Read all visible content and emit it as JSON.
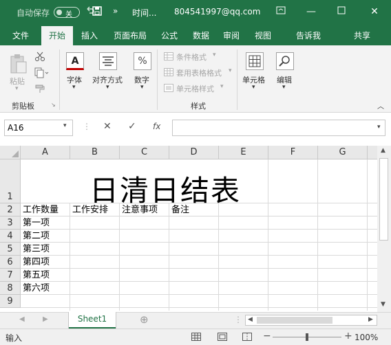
{
  "titlebar": {
    "autosave_label": "自动保存",
    "autosave_state": "关",
    "filename": "时间...",
    "account": "804541997@qq.com"
  },
  "tabs": [
    "文件",
    "开始",
    "插入",
    "页面布局",
    "公式",
    "数据",
    "审阅",
    "视图",
    "告诉我",
    "共享"
  ],
  "ribbon": {
    "paste": "粘贴",
    "clipboard_group": "剪贴板",
    "font": "字体",
    "font_icon": "A",
    "align": "对齐方式",
    "number": "数字",
    "number_icon": "%",
    "cond_format": "条件格式",
    "table_format": "套用表格格式",
    "cell_style": "单元格样式",
    "styles_group": "样式",
    "cells": "单元格",
    "edit": "编辑"
  },
  "formula_bar": {
    "namebox": "A16",
    "fx": "fx",
    "formula": ""
  },
  "grid": {
    "columns": [
      "A",
      "B",
      "C",
      "D",
      "E",
      "F",
      "G"
    ],
    "rows": [
      "1",
      "2",
      "3",
      "4",
      "5",
      "6",
      "7",
      "8",
      "9"
    ],
    "title": "日清日结表",
    "headers": [
      "工作数量",
      "工作安排",
      "注意事项",
      "备注"
    ],
    "items": [
      "第一项",
      "第二项",
      "第三项",
      "第四项",
      "第五项",
      "第六项"
    ]
  },
  "sheet_tab": "Sheet1",
  "status": {
    "mode": "输入",
    "zoom": "100%"
  },
  "colors": {
    "accent": "#217346",
    "ribbon": "#f3f3f3"
  }
}
